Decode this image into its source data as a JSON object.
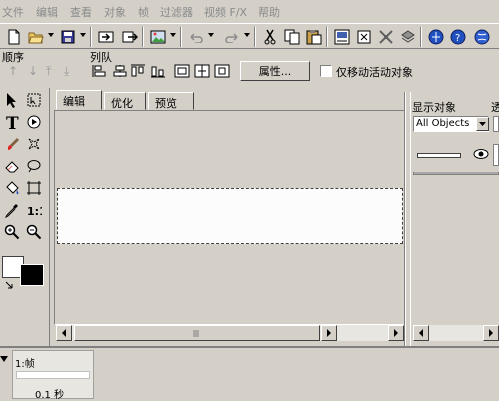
{
  "menubar": {
    "items": [
      "文件",
      "编辑",
      "查看",
      "对象",
      "帧",
      "过滤器",
      "视频 F/X",
      "帮助"
    ]
  },
  "toolbar": {
    "icons": [
      "new-file-icon",
      "open-folder-icon",
      "save-icon",
      "import-icon",
      "export-icon",
      "preview-icon",
      "undo-icon",
      "redo-icon",
      "cut-icon",
      "copy-icon",
      "paste-icon",
      "publish-icon",
      "frame-icon",
      "transform-icon",
      "layer-icon",
      "web-icon",
      "help-icon"
    ]
  },
  "sequence": {
    "order_label": "顺序",
    "queue_label": "列队",
    "properties_button": "属性...",
    "only_move_active_label": "仅移动活动对象"
  },
  "doc_tabs": [
    "编辑",
    "优化",
    "预览"
  ],
  "right_panel": {
    "show_objects_label": "显示对象",
    "transparency_label_partial": "透",
    "object_filter_value": "All Objects"
  },
  "timeline": {
    "frame_label": "1:帧",
    "duration": "0.1 秒"
  },
  "colors": {
    "background": "#d4d0c8",
    "stage": "#fcfcfc",
    "disabled_text": "#8a8a8a",
    "fill_color": "#000000",
    "stroke_color": "#ffffff"
  }
}
